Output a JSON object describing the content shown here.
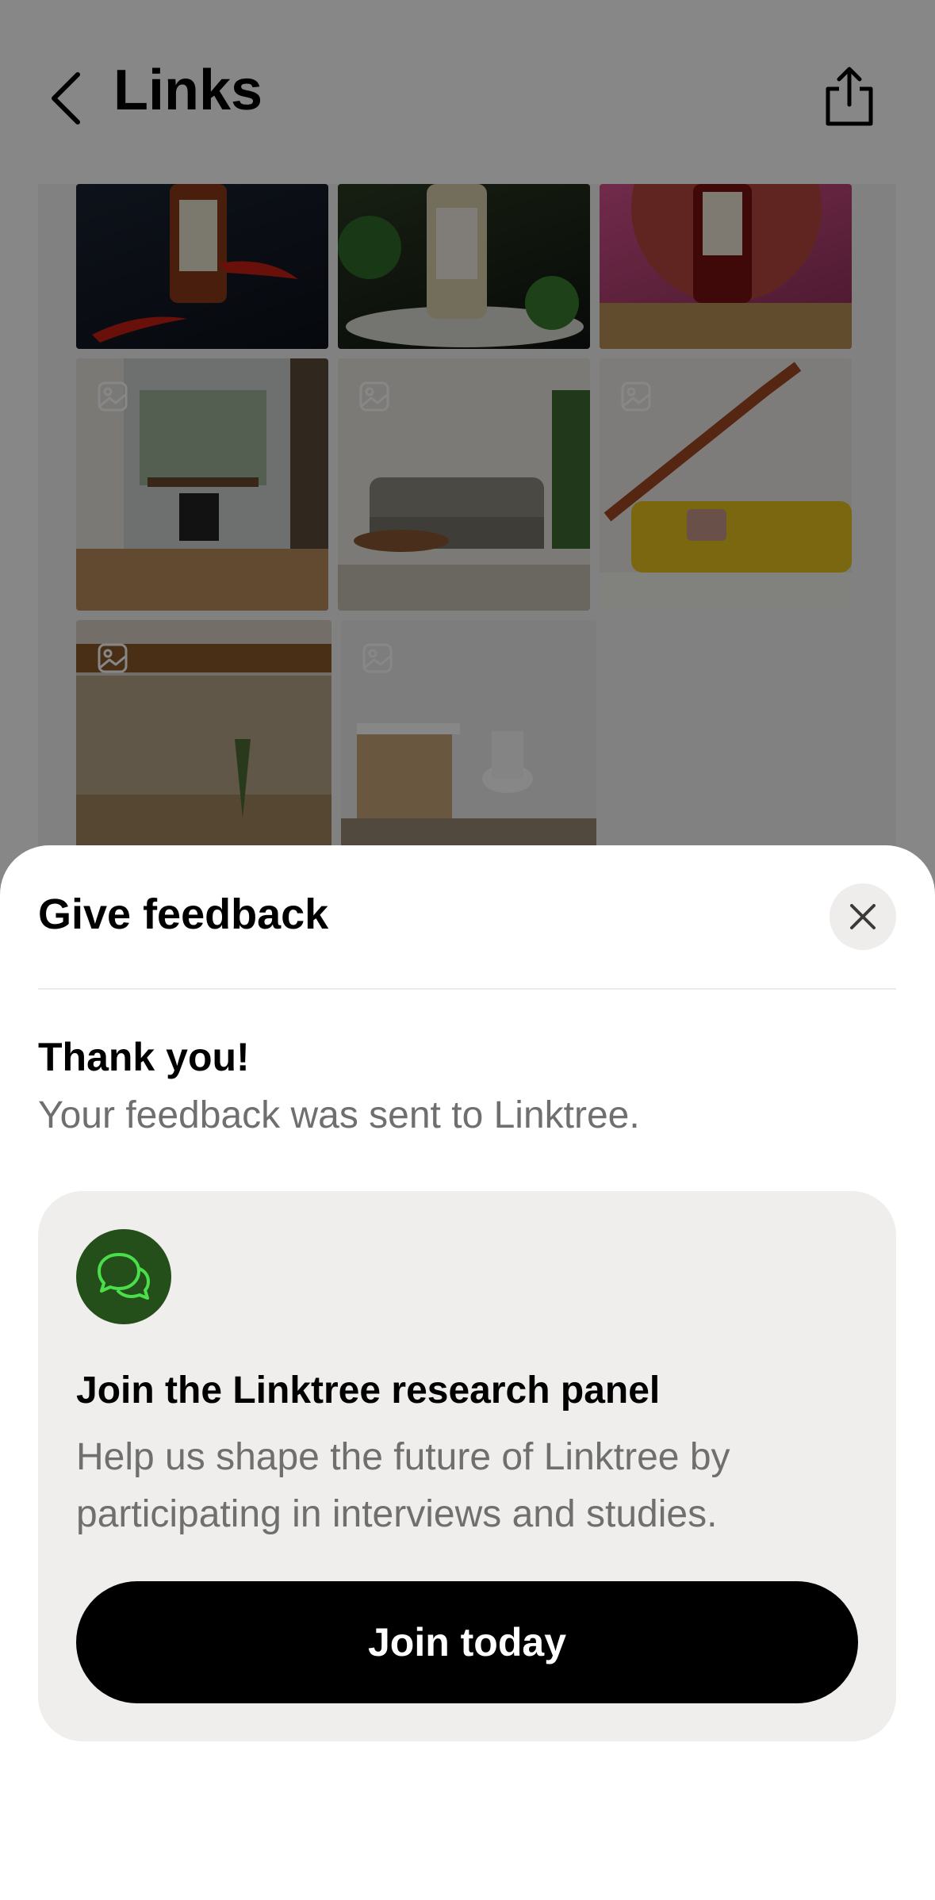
{
  "header": {
    "title": "Links",
    "back_icon": "chevron-left-icon",
    "share_icon": "share-icon"
  },
  "grid": {
    "tiles": [
      {
        "name": "chili-flakes-jar",
        "icon": "image-icon"
      },
      {
        "name": "herb-jar",
        "icon": "image-icon"
      },
      {
        "name": "spice-jar-red",
        "icon": "image-icon"
      },
      {
        "name": "home-office",
        "icon": "image-icon"
      },
      {
        "name": "living-room-sofa",
        "icon": "image-icon"
      },
      {
        "name": "yellow-sofa-staircase",
        "icon": "image-icon"
      },
      {
        "name": "patio-pool",
        "icon": "image-icon"
      },
      {
        "name": "bathroom",
        "icon": "image-icon"
      }
    ]
  },
  "sheet": {
    "title": "Give feedback",
    "close_icon": "close-icon",
    "thanks_title": "Thank you!",
    "thanks_subtitle": "Your feedback was sent to Linktree.",
    "card": {
      "icon": "chat-bubbles-icon",
      "title": "Join the Linktree research panel",
      "description": "Help us shape the future of Linktree by participating in interviews and studies.",
      "button_label": "Join today"
    }
  },
  "colors": {
    "overlay": "#000000",
    "card_bg": "#efeeec",
    "icon_circle": "#254f1a",
    "icon_stroke": "#4ade4a",
    "button_bg": "#000000",
    "muted_text": "#6f6f6f"
  }
}
